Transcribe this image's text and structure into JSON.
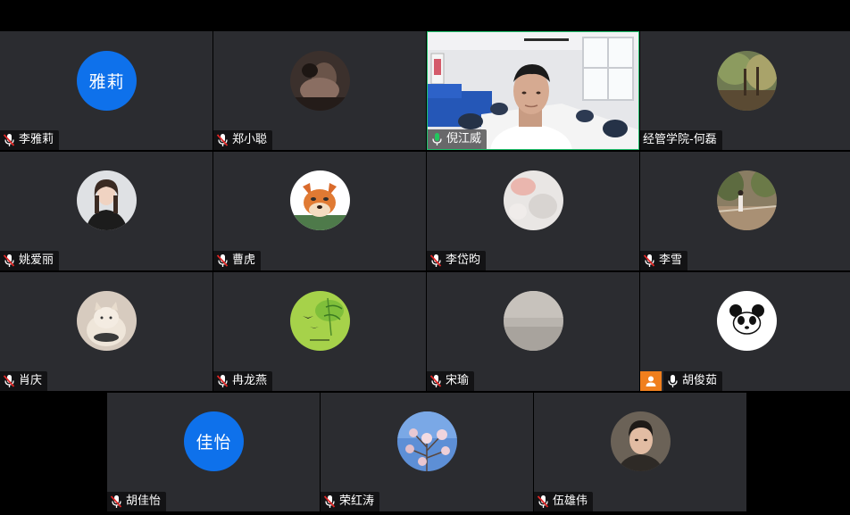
{
  "participants": [
    {
      "name": "李雅莉",
      "avatar_text": "雅莉",
      "mic": "muted"
    },
    {
      "name": "郑小聪",
      "mic": "muted"
    },
    {
      "name": "倪江威",
      "mic": "active"
    },
    {
      "name": "经管学院-何磊",
      "mic": "none"
    },
    {
      "name": "姚爱丽",
      "mic": "muted"
    },
    {
      "name": "曹虎",
      "mic": "muted"
    },
    {
      "name": "李岱昀",
      "mic": "muted"
    },
    {
      "name": "李雪",
      "mic": "muted"
    },
    {
      "name": "肖庆",
      "mic": "muted"
    },
    {
      "name": "冉龙燕",
      "mic": "muted"
    },
    {
      "name": "宋瑜",
      "mic": "muted"
    },
    {
      "name": "胡俊茹",
      "mic": "on"
    },
    {
      "name": "胡佳怡",
      "avatar_text": "佳怡",
      "mic": "muted"
    },
    {
      "name": "荣红涛",
      "mic": "muted"
    },
    {
      "name": "伍雄伟",
      "mic": "muted"
    }
  ],
  "colors": {
    "tile_bg": "#2b2c30",
    "avatar_blue": "#0e71eb",
    "speaking_border": "#1fc06b",
    "mic_muted_red": "#e02828",
    "mic_active_green": "#22c55e",
    "host_badge": "#f07f1d"
  },
  "icons": {
    "mic_muted": "mic-muted-icon",
    "mic_active": "mic-active-icon",
    "mic_on": "mic-icon",
    "host_badge": "person-icon"
  }
}
